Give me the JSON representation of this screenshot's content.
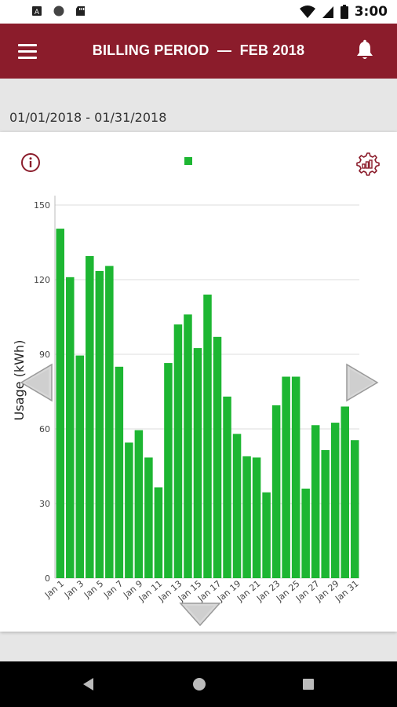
{
  "status_bar": {
    "time": "3:00",
    "icons": [
      "sim-alert-icon",
      "circle-icon",
      "sd-card-icon",
      "wifi-icon",
      "signal-icon",
      "battery-icon"
    ]
  },
  "app_bar": {
    "title": "BILLING PERIOD  —  FEB 2018",
    "menu_icon": "hamburger-menu-icon",
    "notification_icon": "bell-icon",
    "background_color": "#8b1c2b"
  },
  "date_range": "01/01/2018 - 01/31/2018",
  "card": {
    "info_icon": "info-icon",
    "settings_icon": "gear-chart-icon",
    "prev_icon": "arrow-left-icon",
    "next_icon": "arrow-right-icon",
    "expand_icon": "arrow-down-icon"
  },
  "chart_data": {
    "type": "bar",
    "ylabel": "Usage (kWh)",
    "xlabel": "",
    "ylim": [
      0,
      150
    ],
    "yticks": [
      0,
      30,
      60,
      90,
      120,
      150
    ],
    "grid": true,
    "bar_color": "#1db632",
    "categories": [
      "Jan 1",
      "Jan 2",
      "Jan 3",
      "Jan 4",
      "Jan 5",
      "Jan 6",
      "Jan 7",
      "Jan 8",
      "Jan 9",
      "Jan 10",
      "Jan 11",
      "Jan 12",
      "Jan 13",
      "Jan 14",
      "Jan 15",
      "Jan 16",
      "Jan 17",
      "Jan 18",
      "Jan 19",
      "Jan 20",
      "Jan 21",
      "Jan 22",
      "Jan 23",
      "Jan 24",
      "Jan 25",
      "Jan 26",
      "Jan 27",
      "Jan 28",
      "Jan 29",
      "Jan 30",
      "Jan 31"
    ],
    "tick_labels": [
      "Jan 1",
      "Jan 3",
      "Jan 5",
      "Jan 7",
      "Jan 9",
      "Jan 11",
      "Jan 13",
      "Jan 15",
      "Jan 17",
      "Jan 19",
      "Jan 21",
      "Jan 23",
      "Jan 25",
      "Jan 27",
      "Jan 29",
      "Jan 31"
    ],
    "values": [
      140.5,
      121,
      89.5,
      129.5,
      123.5,
      125.5,
      85,
      54.5,
      59.5,
      48.5,
      36.5,
      86.5,
      102,
      106,
      92.5,
      114,
      97,
      73,
      58,
      49,
      48.5,
      34.5,
      69.5,
      81,
      81,
      36,
      61.5,
      51.5,
      62.5,
      69,
      55.5
    ]
  }
}
